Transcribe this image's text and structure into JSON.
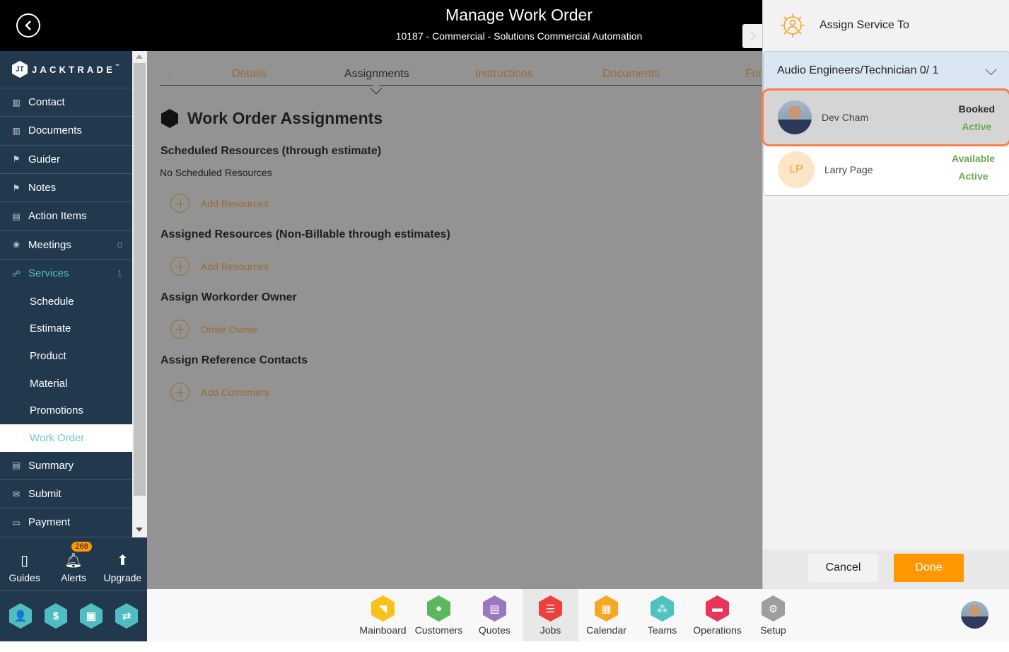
{
  "header": {
    "title": "Manage Work Order",
    "subtitle": "10187 - Commercial - Solutions Commercial Automation"
  },
  "brand": {
    "name": "JACKTRADE",
    "tm": "™",
    "mark": "JT"
  },
  "sidebar": {
    "items": [
      {
        "label": "Contact",
        "icon": "contact-book-icon"
      },
      {
        "label": "Documents",
        "icon": "document-book-icon"
      },
      {
        "label": "Guider",
        "icon": "signpost-icon"
      },
      {
        "label": "Notes",
        "icon": "signpost-icon"
      },
      {
        "label": "Action Items",
        "icon": "clipboard-icon"
      },
      {
        "label": "Meetings",
        "icon": "meeting-icon",
        "count": "0"
      },
      {
        "label": "Services",
        "icon": "services-icon",
        "count": "1"
      }
    ],
    "sub_items": [
      {
        "label": "Schedule"
      },
      {
        "label": "Estimate"
      },
      {
        "label": "Product"
      },
      {
        "label": "Material"
      },
      {
        "label": "Promotions"
      },
      {
        "label": "Work Order"
      }
    ],
    "after_items": [
      {
        "label": "Summary",
        "icon": "summary-icon"
      },
      {
        "label": "Submit",
        "icon": "submit-icon"
      },
      {
        "label": "Payment",
        "icon": "payment-icon"
      }
    ]
  },
  "utilities": {
    "guides": "Guides",
    "alerts": "Alerts",
    "alerts_count": "268",
    "upgrade": "Upgrade"
  },
  "quick_actions": [
    {
      "name": "contact-hex-icon",
      "glyph": "👤"
    },
    {
      "name": "dollar-hex-icon",
      "glyph": "$"
    },
    {
      "name": "money-hex-icon",
      "glyph": "▣"
    },
    {
      "name": "workflow-hex-icon",
      "glyph": "⇄"
    }
  ],
  "tabs": [
    {
      "label": "Details"
    },
    {
      "label": "Assignments",
      "active": true
    },
    {
      "label": "Instructions"
    },
    {
      "label": "Documents"
    },
    {
      "label": "For"
    }
  ],
  "content": {
    "title": "Work Order Assignments",
    "scheduled_heading": "Scheduled Resources (through estimate)",
    "scheduled_empty": "No Scheduled Resources",
    "scheduled_add": "Add Resources",
    "assigned_heading": "Assigned Resources (Non-Billable through estimates)",
    "assigned_add": "Add Resources",
    "owner_heading": "Assign Workorder Owner",
    "owner_add": "Order Owner",
    "contacts_heading": "Assign Reference Contacts",
    "contacts_add": "Add Customers"
  },
  "panel": {
    "title": "Assign Service To",
    "group_label": "Audio Engineers/Technician 0/ 1",
    "resources": [
      {
        "name": "Dev Cham",
        "status": "Booked",
        "state": "Active",
        "selected": true
      },
      {
        "name": "Larry Page",
        "initials": "LP",
        "status": "Available",
        "state": "Active"
      }
    ],
    "cancel": "Cancel",
    "done": "Done"
  },
  "apps": [
    {
      "label": "Mainboard",
      "color": "#f9c21b",
      "glyph": "◥"
    },
    {
      "label": "Customers",
      "color": "#5cb85c",
      "glyph": "●"
    },
    {
      "label": "Quotes",
      "color": "#9c77c0",
      "glyph": "▤"
    },
    {
      "label": "Jobs",
      "color": "#ef3f3a",
      "glyph": "☰",
      "active": true
    },
    {
      "label": "Calendar",
      "color": "#f7a823",
      "glyph": "▦"
    },
    {
      "label": "Teams",
      "color": "#4fc1c0",
      "glyph": "⁂"
    },
    {
      "label": "Operations",
      "color": "#e8365a",
      "glyph": "▬"
    },
    {
      "label": "Setup",
      "color": "#9e9e9e",
      "glyph": "⚙"
    }
  ],
  "colors": {
    "accent": "#ff9800",
    "sidebar": "#22384d",
    "teal": "#4fbdc1",
    "link": "#9a6a32",
    "selection": "#ff7a45"
  }
}
